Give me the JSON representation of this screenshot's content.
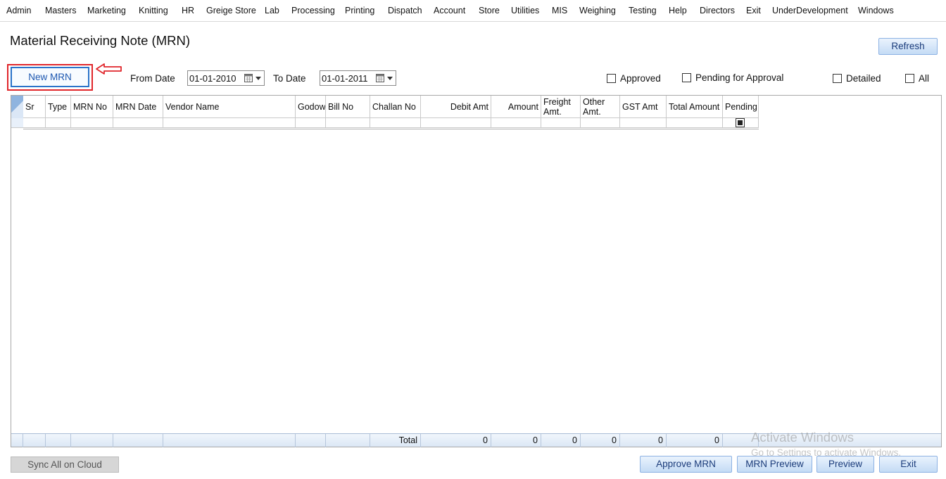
{
  "menu": [
    "Admin",
    "Masters",
    "Marketing",
    "Knitting",
    "HR",
    "Greige Store",
    "Lab",
    "Processing",
    "Printing",
    "Dispatch",
    "Account",
    "Store",
    "Utilities",
    "MIS",
    "Weighing",
    "Testing",
    "Help",
    "Directors",
    "Exit",
    "UnderDevelopment",
    "Windows"
  ],
  "page": {
    "title": "Material Receiving Note (MRN)"
  },
  "toolbar": {
    "refresh": "Refresh",
    "new_mrn": "New MRN",
    "from_date_label": "From Date",
    "from_date": "01-01-2010",
    "to_date_label": "To Date",
    "to_date": "01-01-2011"
  },
  "filters": {
    "approved": "Approved",
    "pending_for_approval": "Pending for Approval",
    "detailed": "Detailed",
    "all": "All"
  },
  "grid": {
    "columns": [
      "Sr",
      "Type",
      "MRN No",
      "MRN Date",
      "Vendor Name",
      "Godow",
      "Bill No",
      "Challan No",
      "Debit Amt",
      "Amount",
      "Freight Amt.",
      "Other Amt.",
      "GST Amt",
      "Total Amount",
      "Pending"
    ],
    "totals": {
      "label": "Total",
      "debit_amt": "0",
      "amount": "0",
      "freight_amt": "0",
      "other_amt": "0",
      "gst_amt": "0",
      "total_amount": "0"
    }
  },
  "watermark": {
    "line1": "Activate Windows",
    "line2": "Go to Settings to activate Windows."
  },
  "footer": {
    "sync": "Sync All on Cloud",
    "approve": "Approve MRN",
    "mrn_preview": "MRN Preview",
    "preview": "Preview",
    "exit": "Exit"
  },
  "colors": {
    "highlight": "#e0262b",
    "button_border": "#8db2e3",
    "accent": "#2a73c9"
  },
  "icons": [
    "calendar-icon",
    "dropdown-arrow-icon",
    "red-left-arrow-icon",
    "row-selector-icon"
  ]
}
